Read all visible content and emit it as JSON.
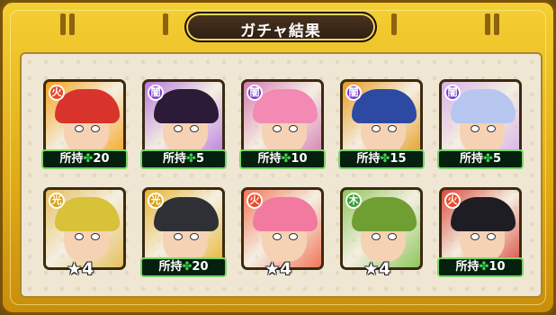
{
  "title": "ガチャ結果",
  "rows": [
    [
      {
        "element": "fire",
        "element_color": "#e64a2b",
        "bg": "#f7a21b",
        "hair": "#d9342c",
        "status_type": "owned",
        "label": "所持",
        "count": "20"
      },
      {
        "element": "dark",
        "element_color": "#7c3bd1",
        "bg": "#b77ae0",
        "hair": "#2b1b38",
        "status_type": "owned",
        "label": "所持",
        "count": "5"
      },
      {
        "element": "dark",
        "element_color": "#7c3bd1",
        "bg": "#d57bb2",
        "hair": "#f28ab3",
        "status_type": "owned",
        "label": "所持",
        "count": "10"
      },
      {
        "element": "dark",
        "element_color": "#7c3bd1",
        "bg": "#e69a20",
        "hair": "#2d4aa3",
        "status_type": "owned",
        "label": "所持",
        "count": "15"
      },
      {
        "element": "dark",
        "element_color": "#7c3bd1",
        "bg": "#d7b0e8",
        "hair": "#b6c6ef",
        "status_type": "owned",
        "label": "所持",
        "count": "5"
      }
    ],
    [
      {
        "element": "light",
        "element_color": "#d9a11a",
        "bg": "#e6c05e",
        "hair": "#d8c23a",
        "status_type": "star",
        "stars": "4"
      },
      {
        "element": "light",
        "element_color": "#d9a11a",
        "bg": "#e8b431",
        "hair": "#2e3036",
        "status_type": "owned",
        "label": "所持",
        "count": "20"
      },
      {
        "element": "fire",
        "element_color": "#e64a2b",
        "bg": "#f2765b",
        "hair": "#f27aa0",
        "status_type": "star",
        "stars": "4"
      },
      {
        "element": "wood",
        "element_color": "#3a9f32",
        "bg": "#8cc75a",
        "hair": "#6f9f33",
        "status_type": "star",
        "stars": "4"
      },
      {
        "element": "fire",
        "element_color": "#e64a2b",
        "bg": "#d94c3f",
        "hair": "#1f1d24",
        "status_type": "owned",
        "label": "所持",
        "count": "10"
      }
    ]
  ]
}
